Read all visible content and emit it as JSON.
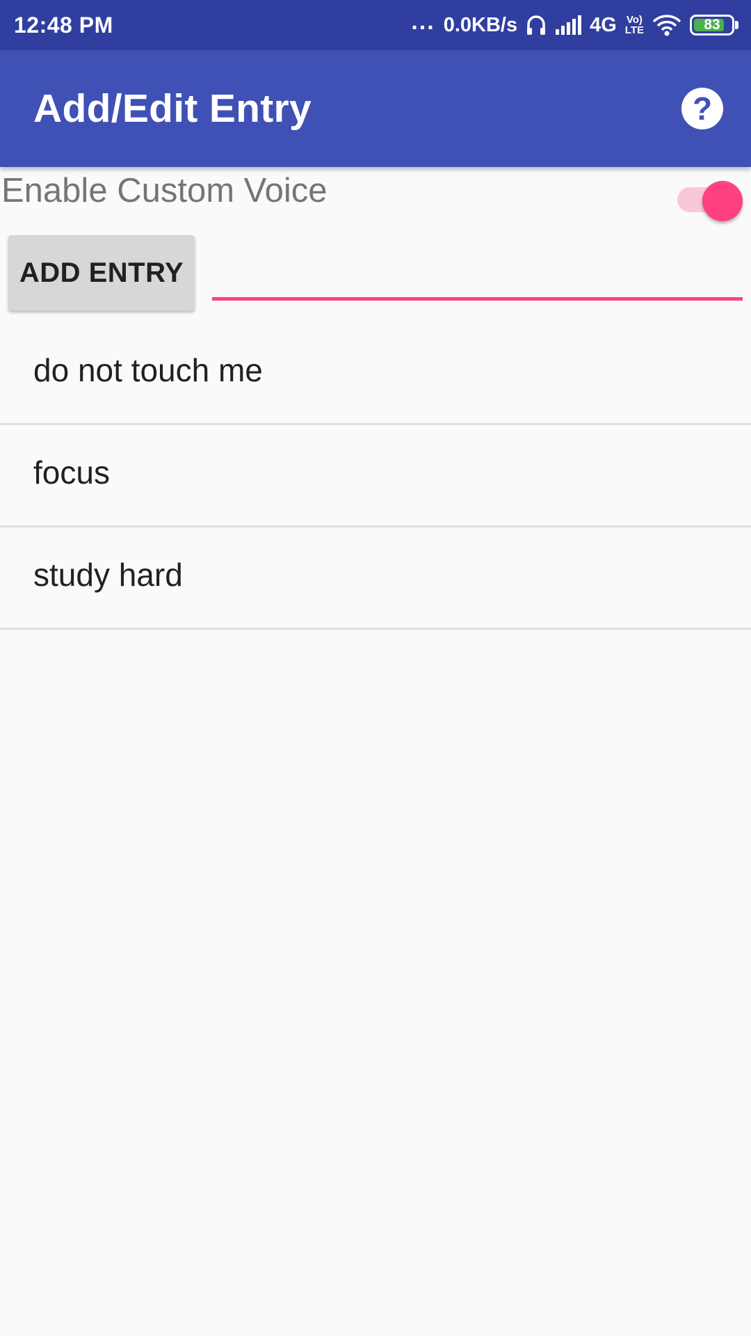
{
  "status_bar": {
    "time": "12:48 PM",
    "dots": "...",
    "net_speed": "0.0KB/s",
    "network": "4G",
    "volte_top": "Vo)",
    "volte_bottom": "LTE",
    "battery": "83",
    "battery_level": 0.83,
    "icons": [
      "headphones-icon",
      "signal-icon",
      "wifi-icon",
      "battery-icon"
    ]
  },
  "app_bar": {
    "title": "Add/Edit Entry",
    "help_icon": "?"
  },
  "settings": {
    "custom_voice_label": "Enable Custom Voice",
    "custom_voice_enabled": true
  },
  "add_entry": {
    "button_label": "ADD ENTRY",
    "input_value": "",
    "input_placeholder": ""
  },
  "entries": [
    {
      "text": "do not touch me"
    },
    {
      "text": "focus"
    },
    {
      "text": "study hard"
    }
  ],
  "colors": {
    "status_bar": "#303f9f",
    "primary": "#3f51b5",
    "accent": "#ff4081",
    "battery": "#4caf50"
  }
}
